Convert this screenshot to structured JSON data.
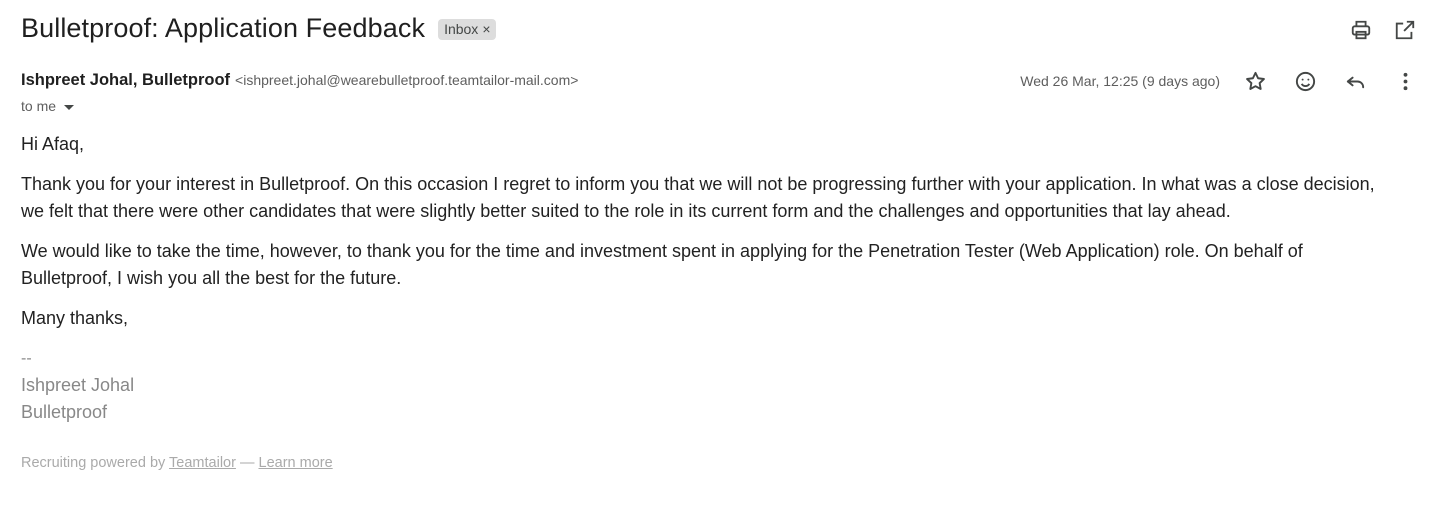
{
  "email": {
    "subject": "Bulletproof: Application Feedback",
    "label": "Inbox",
    "label_remove": "×",
    "sender_name": "Ishpreet Johal, Bulletproof",
    "sender_email": "<ishpreet.johal@wearebulletproof.teamtailor-mail.com>",
    "recipient": "to me",
    "date": "Wed 26 Mar, 12:25 (9 days ago)"
  },
  "body": {
    "greeting": "Hi Afaq,",
    "paragraph1": "Thank you for your interest in Bulletproof. On this occasion I regret to inform you that we will not be progressing further with your application. In what was a close decision, we felt that there were other candidates that were slightly better suited to the role in its current form and the challenges and opportunities that lay ahead.",
    "paragraph2": "We would like to take the time, however, to thank you for the time and investment spent in applying for the Penetration Tester (Web Application) role. On behalf of Bulletproof, I wish you all the best for the future.",
    "closing": "Many thanks,",
    "sig_separator": "--",
    "sig_name": "Ishpreet Johal",
    "sig_company": "Bulletproof"
  },
  "footer": {
    "prefix": "Recruiting powered by ",
    "link1": "Teamtailor",
    "separator": " — ",
    "link2": "Learn more"
  },
  "icons": {
    "print": "print-icon",
    "open_new_window": "open-in-new-window-icon",
    "star": "star-icon",
    "emoji": "emoji-reaction-icon",
    "reply": "reply-icon",
    "more": "more-vert-icon"
  }
}
